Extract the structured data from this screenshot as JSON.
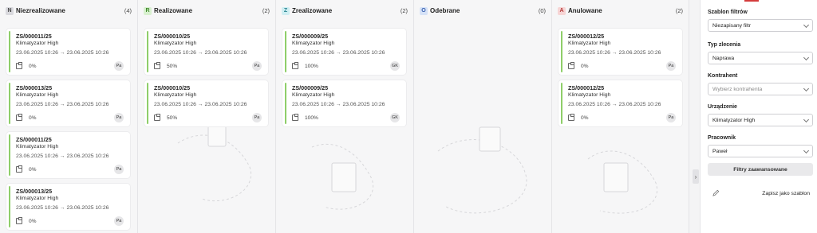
{
  "columns": [
    {
      "letter": "N",
      "title": "Niezrealizowane",
      "count": "(4)",
      "letter_bg": "#d9d9de",
      "letter_fg": "#444444",
      "cards": [
        {
          "number": "ZS/000011/25",
          "device": "Klimatyzator High",
          "dates": "23.06.2025 10:26 → 23.06.2025 10:26",
          "progress": "0%",
          "initials": "Pa"
        },
        {
          "number": "ZS/000013/25",
          "device": "Klimatyzator High",
          "dates": "23.06.2025 10:26 → 23.06.2025 10:26",
          "progress": "0%",
          "initials": "Pa"
        },
        {
          "number": "ZS/000011/25",
          "device": "Klimatyzator High",
          "dates": "23.06.2025 10:26 → 23.06.2025 10:26",
          "progress": "0%",
          "initials": "Pa"
        },
        {
          "number": "ZS/000013/25",
          "device": "Klimatyzator High",
          "dates": "23.06.2025 10:26 → 23.06.2025 10:26",
          "progress": "0%",
          "initials": "Pa"
        }
      ]
    },
    {
      "letter": "R",
      "title": "Realizowane",
      "count": "(2)",
      "letter_bg": "#d8f0cf",
      "letter_fg": "#3f8a2a",
      "cards": [
        {
          "number": "ZS/000010/25",
          "device": "Klimatyzator High",
          "dates": "23.06.2025 10:26 → 23.06.2025 10:26",
          "progress": "50%",
          "initials": "Pa"
        },
        {
          "number": "ZS/000010/25",
          "device": "Klimatyzator High",
          "dates": "23.06.2025 10:26 → 23.06.2025 10:26",
          "progress": "50%",
          "initials": "Pa"
        }
      ]
    },
    {
      "letter": "Z",
      "title": "Zrealizowane",
      "count": "(2)",
      "letter_bg": "#cfeef2",
      "letter_fg": "#2a8591",
      "cards": [
        {
          "number": "ZS/000009/25",
          "device": "Klimatyzator High",
          "dates": "23.06.2025 10:26 → 23.06.2025 10:26",
          "progress": "100%",
          "initials": "GK"
        },
        {
          "number": "ZS/000009/25",
          "device": "Klimatyzator High",
          "dates": "23.06.2025 10:26 → 23.06.2025 10:26",
          "progress": "100%",
          "initials": "GK"
        }
      ]
    },
    {
      "letter": "O",
      "title": "Odebrane",
      "count": "(0)",
      "letter_bg": "#d6e2f7",
      "letter_fg": "#3a62b0",
      "cards": []
    },
    {
      "letter": "A",
      "title": "Anulowane",
      "count": "(2)",
      "letter_bg": "#f7d5d5",
      "letter_fg": "#b43a3a",
      "cards": [
        {
          "number": "ZS/000012/25",
          "device": "Klimatyzator High",
          "dates": "23.06.2025 10:26 → 23.06.2025 10:26",
          "progress": "0%",
          "initials": "Pa"
        },
        {
          "number": "ZS/000012/25",
          "device": "Klimatyzator High",
          "dates": "23.06.2025 10:26 → 23.06.2025 10:26",
          "progress": "0%",
          "initials": "Pa"
        }
      ]
    }
  ],
  "sidebar": {
    "template_label": "Szablon filtrów",
    "template_value": "Niezapisany filtr",
    "type_label": "Typ zlecenia",
    "type_value": "Naprawa",
    "contractor_label": "Kontrahent",
    "contractor_placeholder": "Wybierz kontrahenta",
    "device_label": "Urządzenie",
    "device_value": "Klimatyzator High",
    "employee_label": "Pracownik",
    "employee_value": "Paweł",
    "advanced_button": "Filtry zaawansowane",
    "save_template": "Zapisz jako szablon"
  },
  "colors": {
    "card_bar": "#8fce6a",
    "accent": "#d43b3b"
  },
  "icons": {
    "toggle": "chevron-right-icon",
    "card_footer": "clipboard-icon",
    "save": "pencil-icon"
  }
}
